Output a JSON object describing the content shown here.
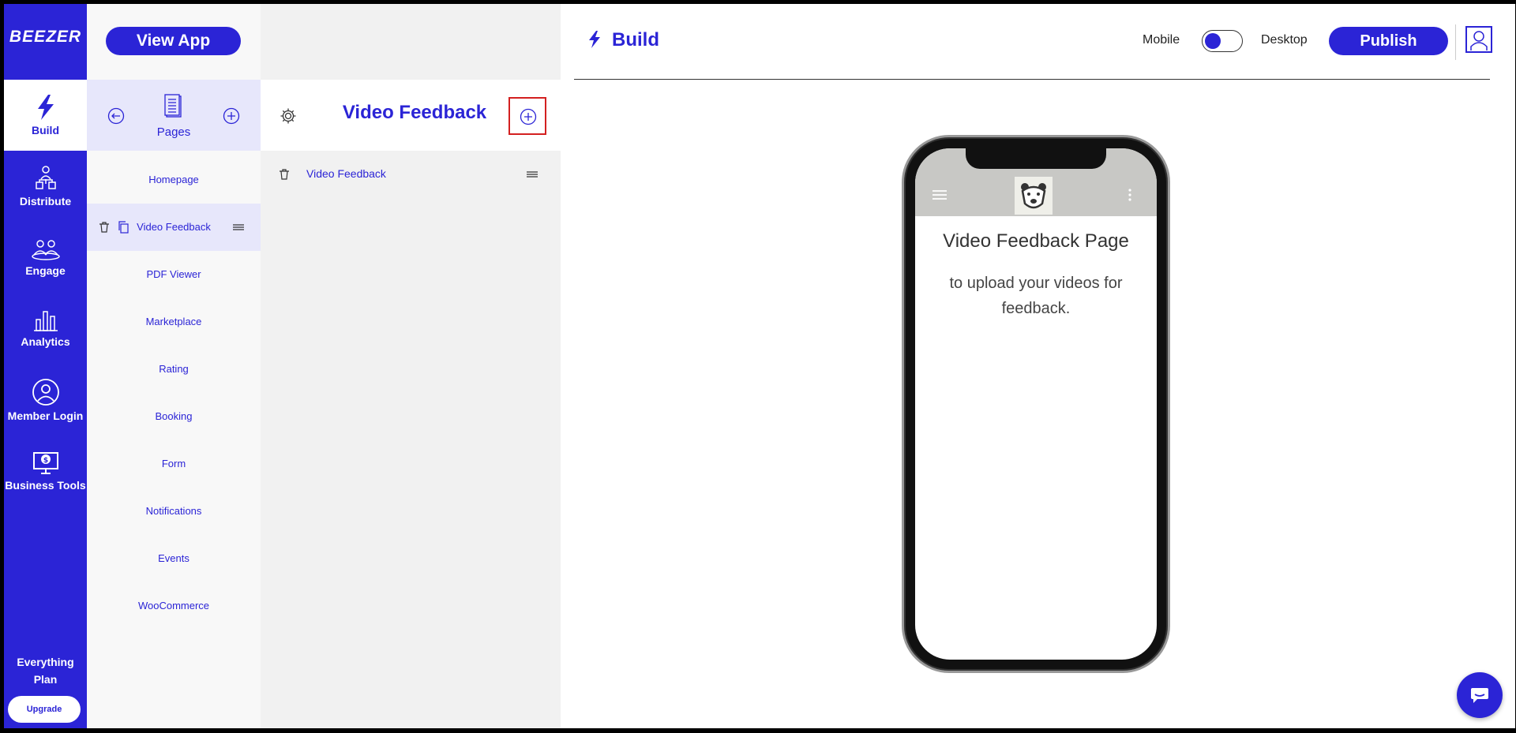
{
  "nav": {
    "logo": "BEEZER",
    "items": [
      {
        "label": "Build",
        "icon": "lightning-icon"
      },
      {
        "label": "Distribute",
        "icon": "distribute-icon"
      },
      {
        "label": "Engage",
        "icon": "engage-icon"
      },
      {
        "label": "Analytics",
        "icon": "bar-chart-icon"
      },
      {
        "label": "Member Login",
        "icon": "user-circle-icon"
      },
      {
        "label": "Business Tools",
        "icon": "monitor-dollar-icon"
      }
    ],
    "plan": "Everything Plan",
    "upgrade": "Upgrade"
  },
  "pages": {
    "view_app": "View App",
    "label": "Pages",
    "items": [
      "Homepage",
      "Video Feedback",
      "PDF Viewer",
      "Marketplace",
      "Rating",
      "Booking",
      "Form",
      "Notifications",
      "Events",
      "WooCommerce"
    ]
  },
  "editor": {
    "title": "Video Feedback",
    "items": [
      "Video Feedback"
    ]
  },
  "main": {
    "title": "Build",
    "mobile": "Mobile",
    "desktop": "Desktop",
    "publish": "Publish"
  },
  "preview": {
    "title": "Video Feedback Page",
    "text": "to upload your videos for feedback."
  },
  "colors": {
    "accent": "#2b24d6",
    "highlight": "#d32020"
  }
}
